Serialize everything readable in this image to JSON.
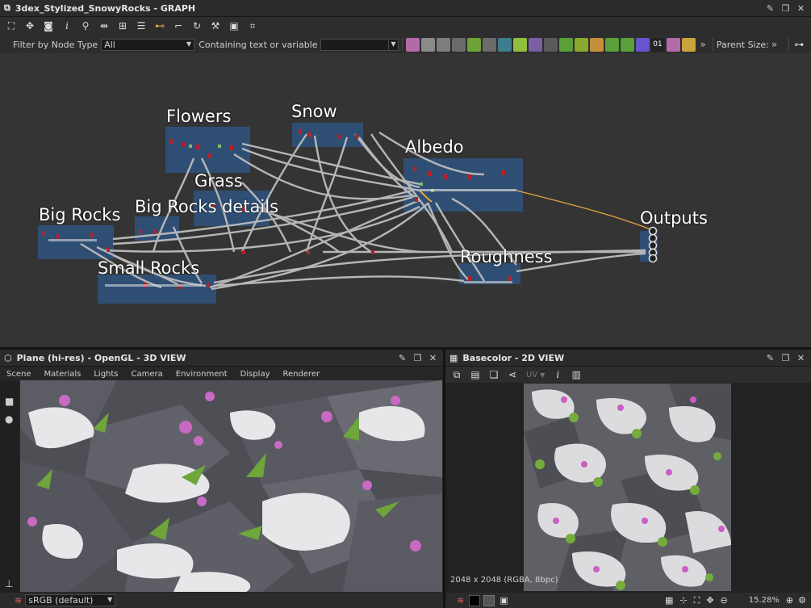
{
  "graph_panel": {
    "title": "3dex_Stylized_SnowyRocks - GRAPH",
    "filter_label": "Filter by Node Type",
    "filter_value": "All",
    "containing_label": "Containing text or variable",
    "containing_value": "",
    "more_label": "»",
    "parent_size_label": "Parent Size:",
    "more_label_2": "»",
    "frames": [
      {
        "label": "Flowers"
      },
      {
        "label": "Snow"
      },
      {
        "label": "Albedo"
      },
      {
        "label": "Grass"
      },
      {
        "label": "Big Rocks"
      },
      {
        "label": "Big Rocks details"
      },
      {
        "label": "Small Rocks"
      },
      {
        "label": "Roughness"
      },
      {
        "label": "Outputs"
      }
    ],
    "toolbar_icons": [
      "frame-icon",
      "center-icon",
      "camera-icon",
      "info-icon",
      "search-icon",
      "link-icon",
      "hierarchy-icon",
      "layers-icon",
      "connection-icon",
      "branch-icon",
      "refresh-icon",
      "tools-icon",
      "export-icon",
      "grid-icon"
    ],
    "node_chips": [
      {
        "name": "image-node-icon",
        "color": "#b36aa8"
      },
      {
        "name": "uniform-node-icon",
        "color": "#8a8a8a"
      },
      {
        "name": "blend-node-icon",
        "color": "#7d7d7d"
      },
      {
        "name": "transform-node-icon",
        "color": "#6b6b6b"
      },
      {
        "name": "curve-node-icon",
        "color": "#6ea335"
      },
      {
        "name": "levels-node-icon",
        "color": "#6b6b6b"
      },
      {
        "name": "gradient-node-icon",
        "color": "#3d7d8e"
      },
      {
        "name": "warp-node-icon",
        "color": "#8fbf3e"
      },
      {
        "name": "shape-node-icon",
        "color": "#7a5fa3"
      },
      {
        "name": "tile-node-icon",
        "color": "#5a5a5a"
      },
      {
        "name": "output-node-icon",
        "color": "#5a9f3a"
      },
      {
        "name": "normal-node-icon",
        "color": "#8aa72e"
      },
      {
        "name": "pixel-node-icon",
        "color": "#c58f3a"
      },
      {
        "name": "ao-node-icon",
        "color": "#5a9f3a"
      },
      {
        "name": "height-node-icon",
        "color": "#5a9f3a"
      },
      {
        "name": "color-wheel-node-icon",
        "color": "#6655cc"
      },
      {
        "name": "noise-node-icon",
        "color": "#222222"
      },
      {
        "name": "dither-node-icon",
        "color": "#b36aa8"
      },
      {
        "name": "warning-node-icon",
        "color": "#c9a43a"
      }
    ],
    "noise_chip_text": "01"
  },
  "view3d": {
    "title": "Plane (hi-res) - OpenGL - 3D VIEW",
    "menu": [
      "Scene",
      "Materials",
      "Lights",
      "Camera",
      "Environment",
      "Display",
      "Renderer"
    ],
    "colorspace": "sRGB (default)"
  },
  "view2d": {
    "title": "Basecolor - 2D VIEW",
    "uv_label": "UV",
    "resolution_text": "2048 x 2048 (RGBA, 8bpc)",
    "zoom": "15.28%"
  }
}
